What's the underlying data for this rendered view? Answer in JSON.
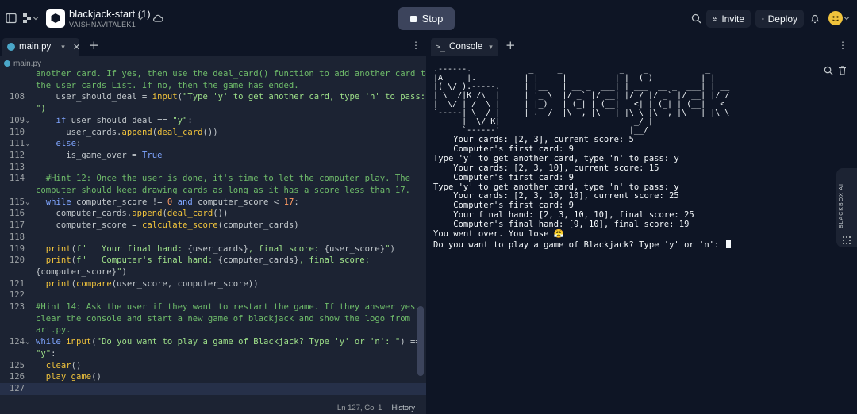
{
  "header": {
    "repl_title": "blackjack-start (1)",
    "repl_owner": "VAISHNAVITALEK1",
    "stop_label": "Stop",
    "invite_label": "Invite",
    "deploy_label": "Deploy"
  },
  "editor": {
    "tab_label": "main.py",
    "breadcrumb": "main.py",
    "lines": [
      {
        "num": "",
        "fold": false,
        "parts": [
          {
            "t": "another card. If yes, then use the deal_card() function to add another card to",
            "c": "cm"
          }
        ]
      },
      {
        "num": "",
        "fold": false,
        "parts": [
          {
            "t": "the user_cards List. If no, then the game has ended.",
            "c": "cm"
          }
        ]
      },
      {
        "num": "108",
        "fold": false,
        "parts": [
          {
            "t": "    user_should_deal = ",
            "c": ""
          },
          {
            "t": "input",
            "c": "fn"
          },
          {
            "t": "(",
            "c": ""
          },
          {
            "t": "\"Type 'y' to get another card, type 'n' to pass:",
            "c": "st"
          }
        ]
      },
      {
        "num": "",
        "fold": false,
        "parts": [
          {
            "t": "\")",
            "c": "st"
          }
        ]
      },
      {
        "num": "109",
        "fold": true,
        "parts": [
          {
            "t": "    ",
            "c": ""
          },
          {
            "t": "if",
            "c": "kw"
          },
          {
            "t": " user_should_deal == ",
            "c": ""
          },
          {
            "t": "\"y\"",
            "c": "st"
          },
          {
            "t": ":",
            "c": ""
          }
        ]
      },
      {
        "num": "110",
        "fold": false,
        "parts": [
          {
            "t": "      user_cards.",
            "c": ""
          },
          {
            "t": "append",
            "c": "fn"
          },
          {
            "t": "(",
            "c": ""
          },
          {
            "t": "deal_card",
            "c": "fn"
          },
          {
            "t": "())",
            "c": ""
          }
        ]
      },
      {
        "num": "111",
        "fold": true,
        "parts": [
          {
            "t": "    ",
            "c": ""
          },
          {
            "t": "else",
            "c": "kw"
          },
          {
            "t": ":",
            "c": ""
          }
        ]
      },
      {
        "num": "112",
        "fold": false,
        "parts": [
          {
            "t": "      is_game_over = ",
            "c": ""
          },
          {
            "t": "True",
            "c": "kw"
          }
        ]
      },
      {
        "num": "113",
        "fold": false,
        "parts": [
          {
            "t": "",
            "c": ""
          }
        ]
      },
      {
        "num": "114",
        "fold": false,
        "parts": [
          {
            "t": "  #Hint 12: Once the user is done, it's time to let the computer play. The",
            "c": "cm"
          }
        ]
      },
      {
        "num": "",
        "fold": false,
        "parts": [
          {
            "t": "computer should keep drawing cards as long as it has a score less than 17.",
            "c": "cm"
          }
        ]
      },
      {
        "num": "115",
        "fold": true,
        "parts": [
          {
            "t": "  ",
            "c": ""
          },
          {
            "t": "while",
            "c": "kw"
          },
          {
            "t": " computer_score != ",
            "c": ""
          },
          {
            "t": "0",
            "c": "nm"
          },
          {
            "t": " ",
            "c": ""
          },
          {
            "t": "and",
            "c": "kw"
          },
          {
            "t": " computer_score < ",
            "c": ""
          },
          {
            "t": "17",
            "c": "nm"
          },
          {
            "t": ":",
            "c": ""
          }
        ]
      },
      {
        "num": "116",
        "fold": false,
        "parts": [
          {
            "t": "    computer_cards.",
            "c": ""
          },
          {
            "t": "append",
            "c": "fn"
          },
          {
            "t": "(",
            "c": ""
          },
          {
            "t": "deal_card",
            "c": "fn"
          },
          {
            "t": "())",
            "c": ""
          }
        ]
      },
      {
        "num": "117",
        "fold": false,
        "parts": [
          {
            "t": "    computer_score = ",
            "c": ""
          },
          {
            "t": "calculate_score",
            "c": "fn"
          },
          {
            "t": "(computer_cards)",
            "c": ""
          }
        ]
      },
      {
        "num": "118",
        "fold": false,
        "parts": [
          {
            "t": "",
            "c": ""
          }
        ]
      },
      {
        "num": "119",
        "fold": false,
        "parts": [
          {
            "t": "  ",
            "c": ""
          },
          {
            "t": "print",
            "c": "fn"
          },
          {
            "t": "(",
            "c": ""
          },
          {
            "t": "f\"   Your final hand: ",
            "c": "st"
          },
          {
            "t": "{user_cards}",
            "c": ""
          },
          {
            "t": ", final score: ",
            "c": "st"
          },
          {
            "t": "{user_score}",
            "c": ""
          },
          {
            "t": "\"",
            "c": "st"
          },
          {
            "t": ")",
            "c": ""
          }
        ]
      },
      {
        "num": "120",
        "fold": false,
        "parts": [
          {
            "t": "  ",
            "c": ""
          },
          {
            "t": "print",
            "c": "fn"
          },
          {
            "t": "(",
            "c": ""
          },
          {
            "t": "f\"   Computer's final hand: ",
            "c": "st"
          },
          {
            "t": "{computer_cards}",
            "c": ""
          },
          {
            "t": ", final score:",
            "c": "st"
          }
        ]
      },
      {
        "num": "",
        "fold": false,
        "parts": [
          {
            "t": "{computer_score}",
            "c": ""
          },
          {
            "t": "\"",
            "c": "st"
          },
          {
            "t": ")",
            "c": ""
          }
        ]
      },
      {
        "num": "121",
        "fold": false,
        "parts": [
          {
            "t": "  ",
            "c": ""
          },
          {
            "t": "print",
            "c": "fn"
          },
          {
            "t": "(",
            "c": ""
          },
          {
            "t": "compare",
            "c": "fn"
          },
          {
            "t": "(user_score, computer_score))",
            "c": ""
          }
        ]
      },
      {
        "num": "122",
        "fold": false,
        "parts": [
          {
            "t": "",
            "c": ""
          }
        ]
      },
      {
        "num": "123",
        "fold": false,
        "parts": [
          {
            "t": "#Hint 14: Ask the user if they want to restart the game. If they answer yes,",
            "c": "cm"
          }
        ]
      },
      {
        "num": "",
        "fold": false,
        "parts": [
          {
            "t": "clear the console and start a new game of blackjack and show the logo from",
            "c": "cm"
          }
        ]
      },
      {
        "num": "",
        "fold": false,
        "parts": [
          {
            "t": "art.py.",
            "c": "cm"
          }
        ]
      },
      {
        "num": "124",
        "fold": true,
        "parts": [
          {
            "t": "while",
            "c": "kw"
          },
          {
            "t": " ",
            "c": ""
          },
          {
            "t": "input",
            "c": "fn"
          },
          {
            "t": "(",
            "c": ""
          },
          {
            "t": "\"Do you want to play a game of Blackjack? Type 'y' or 'n': \"",
            "c": "st"
          },
          {
            "t": ") ==",
            "c": ""
          }
        ]
      },
      {
        "num": "",
        "fold": false,
        "parts": [
          {
            "t": "\"y\"",
            "c": "st"
          },
          {
            "t": ":",
            "c": ""
          }
        ]
      },
      {
        "num": "125",
        "fold": false,
        "parts": [
          {
            "t": "  ",
            "c": ""
          },
          {
            "t": "clear",
            "c": "fn"
          },
          {
            "t": "()",
            "c": ""
          }
        ]
      },
      {
        "num": "126",
        "fold": false,
        "parts": [
          {
            "t": "  ",
            "c": ""
          },
          {
            "t": "play_game",
            "c": "fn"
          },
          {
            "t": "()",
            "c": ""
          }
        ]
      },
      {
        "num": "127",
        "fold": false,
        "current": true,
        "parts": [
          {
            "t": "",
            "c": ""
          }
        ]
      }
    ],
    "status_position": "Ln 127, Col 1",
    "status_history": "History"
  },
  "console": {
    "tab_label": "Console",
    "ascii_logo": ".------.            _     _            _    _            _    \n|A_  _ |.          | |   | |          | |  (_)          | |   \n|( \\/ ).-----.     | |__ | | __ _  ___| | ___  __ _  ___| | __\n| \\  /|K /\\  |     | '_ \\| |/ _` |/ __| |/ / |/ _` |/ __| |/ /\n|  \\/ | /  \\ |     | |_) | | (_| | (__|   <| | (_| | (__|   < \n`-----| \\  / |     |_.__/|_|\\__,_|\\___|_|\\_\\ |\\__,_|\\___|_|\\_\\\n      |  \\/ K|                            _/ |                \n      `------'                           |__/                 ",
    "lines": [
      "    Your cards: [2, 3], current score: 5",
      "    Computer's first card: 9",
      "Type 'y' to get another card, type 'n' to pass: y",
      "    Your cards: [2, 3, 10], current score: 15",
      "    Computer's first card: 9",
      "Type 'y' to get another card, type 'n' to pass: y",
      "    Your cards: [2, 3, 10, 10], current score: 25",
      "    Computer's first card: 9",
      "    Your final hand: [2, 3, 10, 10], final score: 25",
      "    Computer's final hand: [9, 10], final score: 19",
      "You went over. You lose 😤",
      "Do you want to play a game of Blackjack? Type 'y' or 'n': "
    ]
  },
  "sidepanel": {
    "label": "BLACKBOX AI"
  }
}
